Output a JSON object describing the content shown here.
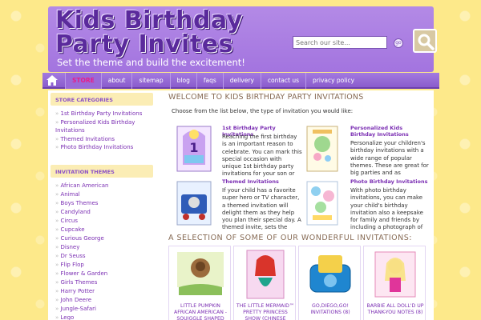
{
  "header": {
    "logo_line1": "Kids Birthday",
    "logo_line2": "Party Invites",
    "tagline": "Set the theme and build the excitement!",
    "search_placeholder": "Search our site...",
    "search_go": "go"
  },
  "nav": {
    "home_icon": "home-icon",
    "items": [
      "STORE",
      "about",
      "sitemap",
      "blog",
      "faqs",
      "delivery",
      "contact us",
      "privacy policy"
    ]
  },
  "sidebar": {
    "categories_heading": "STORE CATEGORIES",
    "categories": [
      "1st Birthday Party Invitations",
      "Personalized Kids Birthday Invitations",
      "Themed Invitations",
      "Photo Birthday Invitations"
    ],
    "themes_heading": "INVITATION THEMES",
    "themes": [
      "African American",
      "Animal",
      "Boys Themes",
      "Candyland",
      "Circus",
      "Cupcake",
      "Curious George",
      "Disney",
      "Dr Seuss",
      "Flip Flop",
      "Flower & Garden",
      "Girls Themes",
      "Harry Potter",
      "John Deere",
      "Jungle-Safari",
      "Lego"
    ]
  },
  "main": {
    "title": "WELCOME TO KIDS BIRTHDAY PARTY INVITATIONS",
    "intro": "Choose from the list below, the type of invitation you would like:",
    "features": [
      {
        "title": "1st Birthday Party Invitations",
        "desc": "Reaching the first birthday is an important reason to celebrate. You can mark this special occasion with unique 1st birthday party invitations for your son or daughter."
      },
      {
        "title": "Personalized Kids Birthday Invitations",
        "desc": "Personalize your children's birthday invitations with a wide range of popular themes. These are great for big parties and as keepsakes. Personalized"
      },
      {
        "title": "Themed Invitations",
        "desc": "If your child has a favorite super hero or TV character, a themed invitation will delight them as they help you plan their special day. A themed invite, sets the mood for the"
      },
      {
        "title": "Photo Birthday Invitations",
        "desc": "With photo birthday invitations, you can make your child's birthday invitation also a keepsake for family and friends by including a photograph of"
      }
    ],
    "selection_title": "A SELECTION OF SOME OF OUR WONDERFUL INVITATIONS:",
    "products": [
      {
        "name": "LITTLE PUMPKIN AFRICAN AMERICAN - SQUIGGLE SHAPED BIRTHDAY PARTY"
      },
      {
        "name": "THE LITTLE MERMAID™ PRETTY PRINCESS SHOW (CHINESE EDITION)"
      },
      {
        "name": "GO,DIEGO,GO! INVITATIONS (8)"
      },
      {
        "name": "BARBIE ALL DOLL'D UP THANK-YOU NOTES (8)"
      }
    ]
  },
  "colors": {
    "page_bg": "#fde98a",
    "header_purple": "#a374df",
    "nav_purple": "#8a5ccc",
    "link_purple": "#7b2fb3",
    "active_pink": "#e61f8a"
  }
}
